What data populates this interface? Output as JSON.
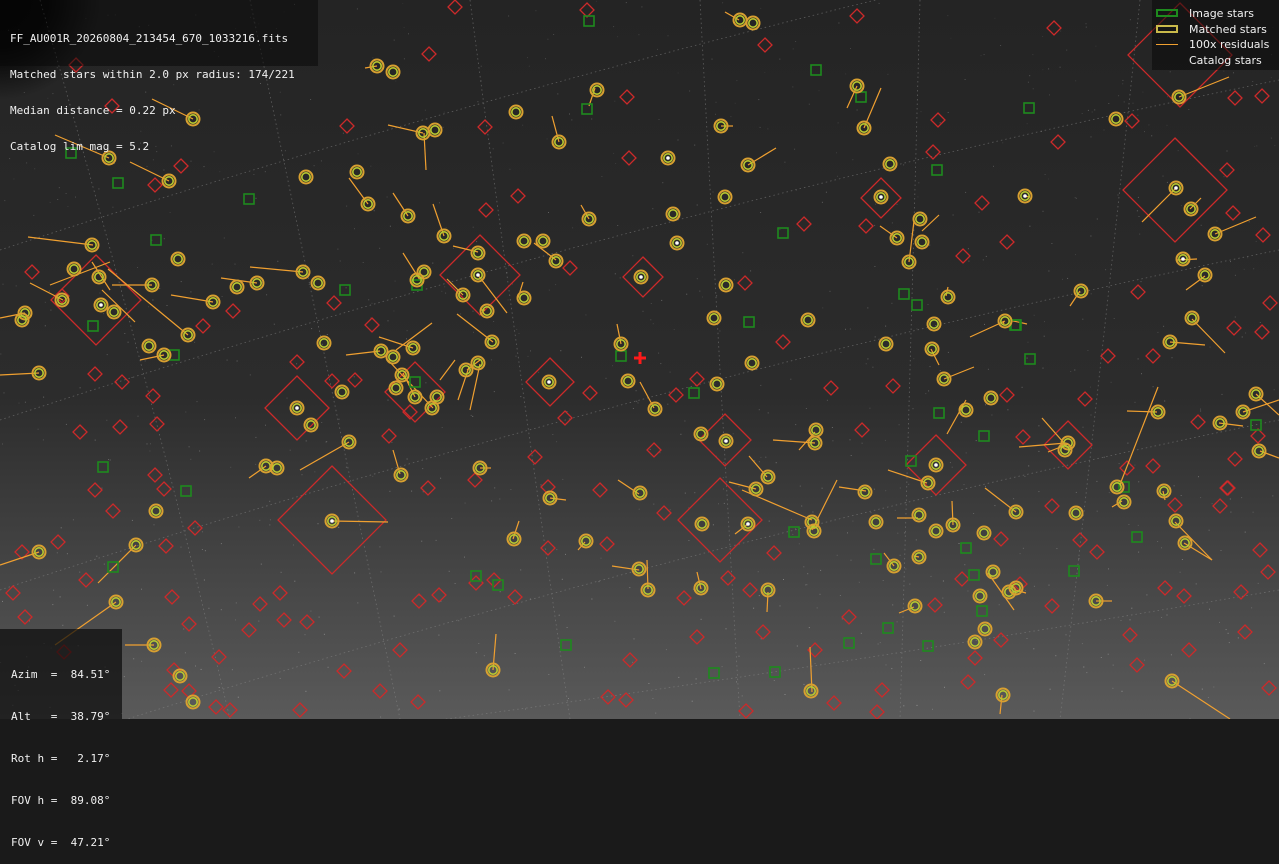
{
  "info_panel": {
    "filename": "FF_AU001R_20260804_213454_670_1033216.fits",
    "matched_line": "Matched stars within 2.0 px radius: 174/221",
    "median_line": "Median distance = 0.22 px",
    "limmag_line": "Catalog lim mag = 5.2"
  },
  "legend": {
    "items": [
      {
        "label": "Image stars",
        "color": "#1e8a1e"
      },
      {
        "label": "Matched stars",
        "color": "#c9b94a"
      },
      {
        "label": "100x residuals",
        "color": "#f0a030"
      },
      {
        "label": "Catalog stars",
        "color": "#cc2a2a"
      }
    ]
  },
  "pointing": {
    "azim": "Azim  =  84.51°",
    "alt": "Alt   =  38.79°",
    "rot": "Rot h =   2.17°",
    "fovh": "FOV h =  89.08°",
    "fovv": "FOV v =  47.21°"
  },
  "colors": {
    "image_star": "#1e8a1e",
    "matched_outer": "#d8a030",
    "matched_inner": "#b8c830",
    "residual": "#f0a030",
    "catalog_star": "#cc2a2a",
    "centre_marker": "#ff1a1a"
  }
}
